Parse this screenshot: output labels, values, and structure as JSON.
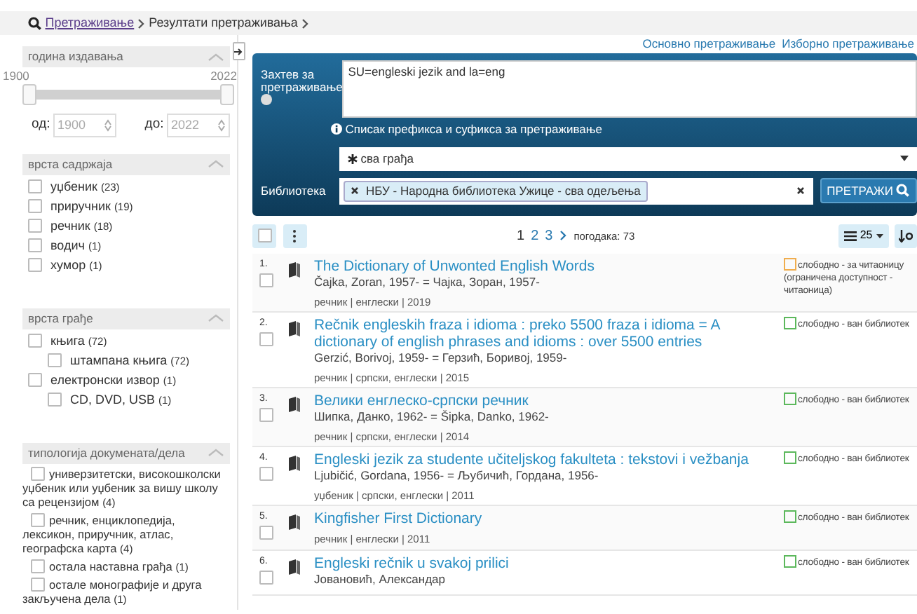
{
  "breadcrumb": [
    {
      "label": "Претраживање",
      "link": true
    },
    {
      "label": "Резултати претраживања",
      "link": false
    }
  ],
  "top_links": [
    "Основно претраживање",
    "Изборно претраживање"
  ],
  "year_filter": {
    "title": "година издавања",
    "min": "1900",
    "max": "2022",
    "thumbs": [
      {
        "level": 0
      },
      {
        "level": 1
      }
    ],
    "from_label": "од:",
    "from_placeholder": "1900",
    "to_label": "до:",
    "to_placeholder": "2022"
  },
  "facets": [
    {
      "title": "врста садржаја",
      "items": [
        {
          "label": "уџбеник",
          "count": "(23)",
          "checked": false
        },
        {
          "label": "приручник",
          "count": "(19)",
          "checked": false
        },
        {
          "label": "речник",
          "count": "(18)",
          "checked": false
        },
        {
          "label": "водич",
          "count": "(1)",
          "checked": false
        },
        {
          "label": "хумор",
          "count": "(1)",
          "checked": false
        }
      ]
    },
    {
      "title": "врста грађе",
      "items": [
        {
          "label": "књига",
          "count": "(72)",
          "checked": false,
          "children": [
            {
              "label": "штампана књига",
              "count": "(72)",
              "checked": false
            }
          ]
        },
        {
          "label": "електронски извор",
          "count": "(1)",
          "checked": false,
          "children": [
            {
              "label": "CD, DVD, USB",
              "count": "(1)",
              "checked": false
            }
          ]
        }
      ]
    },
    {
      "title": "типологија докумената/дела",
      "items": [
        {
          "label": "универзитетски, високошколски уџбеник или уџбеник за вишу школу са рецензијом",
          "count": "(4)",
          "checked": false
        },
        {
          "label": "речник, енциклопедија, лексикон, приручник, атлас, географска карта",
          "count": "(4)",
          "checked": false
        },
        {
          "label": "остала наставна грађа",
          "count": "(1)",
          "checked": false
        },
        {
          "label": "остале монографије и друга закључена дела",
          "count": "(1)",
          "checked": false
        }
      ]
    }
  ],
  "search": {
    "query_label": "Захтев за претраживање",
    "query": "SU=engleski jezik and la=eng",
    "info_link": "Списак префикса и суфикса за претраживање",
    "material": "сва грађа",
    "library_label": "Библиотека",
    "library_tag": "НБУ - Народна библиотека Ужице - сва одељења",
    "button": "ПРЕТРАЖИ"
  },
  "pagination": {
    "pages": [
      {
        "label": "1",
        "selected": true
      },
      {
        "label": "2",
        "selected": false
      },
      {
        "label": "3",
        "selected": false
      }
    ],
    "hits": "погодака: 73",
    "page_size": "25"
  },
  "results": [
    {
      "number": "1.",
      "title": "The Dictionary of Unwonted English Words",
      "author": "Čajka, Zoran, 1957- = Чајка, Зоран, 1957-",
      "meta": "речник | енглески | 2019",
      "status": "слободно - за читаоницу (ограничена доступност - читаоница)",
      "color": "#f0ad4e",
      "checked": false
    },
    {
      "number": "2.",
      "title": "Rečnik engleskih fraza i idioma : preko 5500 fraza i idioma = A dictionary of english phrases and idioms : over 5500 entries",
      "author": "Gerzić, Borivoj, 1959- = Герзић, Боривој, 1959-",
      "meta": "речник | српски, енглески | 2015",
      "status": "слободно - ван библиотек",
      "color": "#5cb85c",
      "checked": false
    },
    {
      "number": "3.",
      "title": "Велики енглеско-српски речник",
      "author": "Шипка, Данко, 1962- = Šipka, Danko, 1962-",
      "meta": "речник | српски, енглески | 2014",
      "status": "слободно - ван библиотек",
      "color": "#5cb85c",
      "checked": false
    },
    {
      "number": "4.",
      "title": "Engleski jezik za studente učiteljskog fakulteta : tekstovi i vežbanja",
      "author": "Ljubičić, Gordana, 1956- = Љубичић, Гордана, 1956-",
      "meta": "уџбеник | српски, енглески | 2011",
      "status": "слободно - ван библиотек",
      "color": "#5cb85c",
      "checked": false
    },
    {
      "number": "5.",
      "title": "Kingfisher First Dictionary",
      "meta": "речник | енглески | 2011",
      "status": "слободно - ван библиотек",
      "color": "#5cb85c",
      "checked": false
    },
    {
      "number": "6.",
      "title": "Engleski rečnik u svakoj prilici",
      "author": "Јовановић, Александар",
      "status": "слободно - ван библиотек",
      "color": "#5cb85c",
      "checked": false
    }
  ]
}
